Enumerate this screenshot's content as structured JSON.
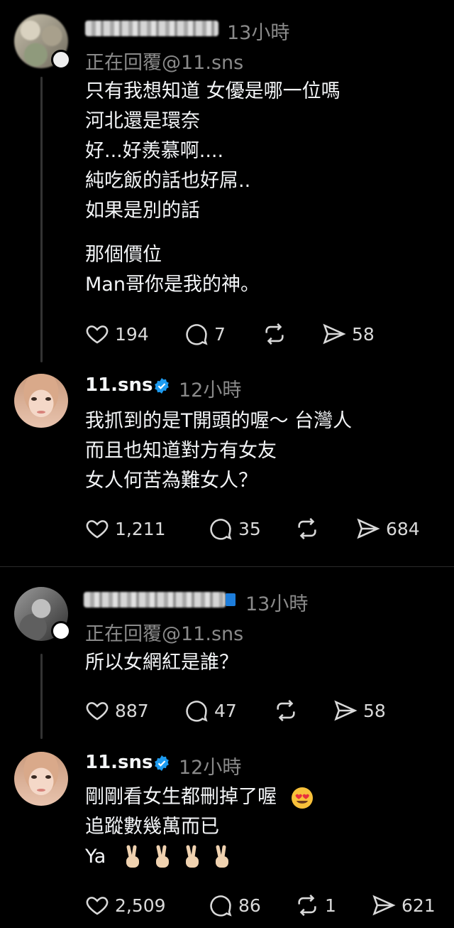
{
  "posts": [
    {
      "time": "13小時",
      "replying": "正在回覆@11.sns",
      "text": "只有我想知道 女優是哪一位嗎\n河北還是環奈\n好...好羨慕啊....\n純吃飯的話也好屌..\n如果是別的話",
      "text2": "那個價位\nMan哥你是我的神。",
      "likes": "194",
      "comments": "7",
      "shares": "58"
    },
    {
      "name": "11.sns",
      "time": "12小時",
      "text": "我抓到的是T開頭的喔～ 台灣人\n而且也知道對方有女友\n女人何苦為難女人？",
      "likes": "1,211",
      "comments": "35",
      "shares": "684"
    },
    {
      "time": "13小時",
      "replying": "正在回覆@11.sns",
      "text": "所以女網紅是誰？",
      "likes": "887",
      "comments": "47",
      "shares": "58"
    },
    {
      "name": "11.sns",
      "time": "12小時",
      "line1": "剛剛看女生都刪掉了喔",
      "line2": "追蹤數幾萬而已",
      "line3": "Ya",
      "likes": "2,509",
      "comments": "86",
      "reposts": "1",
      "shares": "621"
    }
  ],
  "colors": {
    "background": "#000000",
    "text": "#f3f5f7",
    "muted": "#8a8a8a",
    "verified": "#1d9bf0"
  },
  "icons": [
    "heart-icon",
    "comment-icon",
    "repost-icon",
    "share-icon",
    "verified-badge-icon"
  ]
}
